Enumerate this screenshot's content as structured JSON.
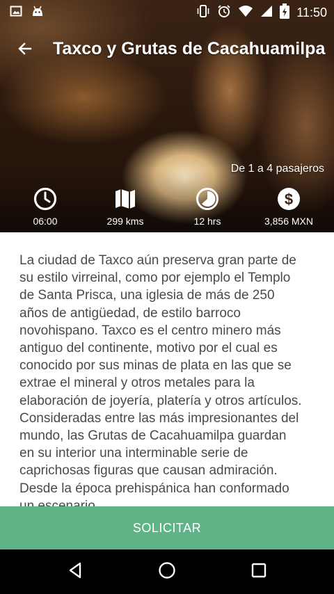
{
  "status_bar": {
    "time": "11:50",
    "icons": [
      "image-icon",
      "android-icon",
      "vibrate-icon",
      "alarm-icon",
      "wifi-icon",
      "signal-icon",
      "battery-charging-icon"
    ]
  },
  "app_bar": {
    "title": "Taxco y Grutas de Cacahuamilpa",
    "back_icon": "back-arrow-icon"
  },
  "hero": {
    "passengers": "De 1 a 4 pasajeros",
    "stats": [
      {
        "icon": "clock-icon",
        "value": "06:00"
      },
      {
        "icon": "map-icon",
        "value": "299 kms"
      },
      {
        "icon": "timer-icon",
        "value": "12 hrs"
      },
      {
        "icon": "dollar-icon",
        "value": "3,856 MXN"
      }
    ]
  },
  "description": "La ciudad de Taxco aún preserva gran parte de su estilo virreinal, como por ejemplo el Templo de Santa Prisca, una iglesia de más de 250 años de antigüedad, de estilo barroco novohispano. Taxco es el centro minero más antiguo del continente, motivo por el cual es conocido por sus minas de plata en las que se extrae el mineral y otros metales para la elaboración de joyería, platería y otros artículos. Consideradas entre las más impresionantes del mundo, las Grutas de Cacahuamilpa guardan en su interior una interminable serie de caprichosas figuras que causan admiración. Desde la época prehispánica han conformado un escenario",
  "button": {
    "label": "SOLICITAR"
  },
  "colors": {
    "accent": "#5fb487",
    "text": "#4a4a4a",
    "nav_bg": "#000000"
  }
}
